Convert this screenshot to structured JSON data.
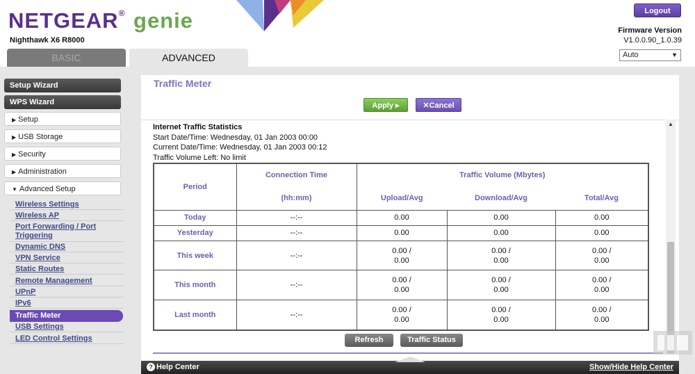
{
  "header": {
    "brand": "NETGEAR",
    "brand_genie": "genie",
    "model": "Nighthawk X6 R8000",
    "logout_label": "Logout",
    "firmware_label": "Firmware Version",
    "firmware_value": "V1.0.0.90_1.0.39",
    "language_selected": "Auto",
    "tabs": [
      {
        "label": "BASIC",
        "active": false
      },
      {
        "label": "ADVANCED",
        "active": true
      }
    ]
  },
  "sidebar": {
    "buttons": [
      {
        "label": "Setup Wizard"
      },
      {
        "label": "WPS Wizard"
      }
    ],
    "sections": [
      {
        "label": "Setup",
        "expanded": false
      },
      {
        "label": "USB Storage",
        "expanded": false
      },
      {
        "label": "Security",
        "expanded": false
      },
      {
        "label": "Administration",
        "expanded": false
      },
      {
        "label": "Advanced Setup",
        "expanded": true
      }
    ],
    "subitems": [
      {
        "label": "Wireless Settings"
      },
      {
        "label": "Wireless AP"
      },
      {
        "label": "Port Forwarding / Port Triggering"
      },
      {
        "label": "Dynamic DNS"
      },
      {
        "label": "VPN Service"
      },
      {
        "label": "Static Routes"
      },
      {
        "label": "Remote Management"
      },
      {
        "label": "UPnP"
      },
      {
        "label": "IPv6"
      },
      {
        "label": "Traffic Meter",
        "active": true
      },
      {
        "label": "USB Settings"
      },
      {
        "label": "LED Control Settings"
      }
    ]
  },
  "main": {
    "title": "Traffic Meter",
    "apply_label": "Apply ▸",
    "cancel_label": "✕Cancel",
    "stats": {
      "heading": "Internet Traffic Statistics",
      "start": "Start Date/Time: Wednesday, 01 Jan 2003 00:00",
      "current": "Current Date/Time: Wednesday, 01 Jan 2003 00:12",
      "volume_left": "Traffic Volume Left: No limit"
    },
    "table": {
      "col_period": "Period",
      "col_conn": "Connection Time",
      "col_conn_unit": "(hh:mm)",
      "col_volume": "Traffic Volume (Mbytes)",
      "col_upload": "Upload/Avg",
      "col_download": "Download/Avg",
      "col_total": "Total/Avg",
      "rows": [
        {
          "period": "Today",
          "conn": "--:--",
          "upload": "0.00",
          "upload2": "",
          "download": "0.00",
          "download2": "",
          "total": "0.00",
          "total2": ""
        },
        {
          "period": "Yesterday",
          "conn": "--:--",
          "upload": "0.00",
          "upload2": "",
          "download": "0.00",
          "download2": "",
          "total": "0.00",
          "total2": ""
        },
        {
          "period": "This week",
          "conn": "--:--",
          "upload": "0.00 /",
          "upload2": "0.00",
          "download": "0.00 /",
          "download2": "0.00",
          "total": "0.00 /",
          "total2": "0.00"
        },
        {
          "period": "This month",
          "conn": "--:--",
          "upload": "0.00 /",
          "upload2": "0.00",
          "download": "0.00 /",
          "download2": "0.00",
          "total": "0.00 /",
          "total2": "0.00"
        },
        {
          "period": "Last month",
          "conn": "--:--",
          "upload": "0.00 /",
          "upload2": "0.00",
          "download": "0.00 /",
          "download2": "0.00",
          "total": "0.00 /",
          "total2": "0.00"
        }
      ]
    },
    "refresh_label": "Refresh",
    "traffic_status_label": "Traffic Status"
  },
  "helpbar": {
    "help_label": "Help Center",
    "toggle_label": "Show/Hide Help Center"
  },
  "colors": {
    "brand_purple": "#5a2f8f",
    "genie_green": "#6aa84f",
    "accent_purple": "#6b4ab5",
    "apply_green": "#5c9e35"
  }
}
